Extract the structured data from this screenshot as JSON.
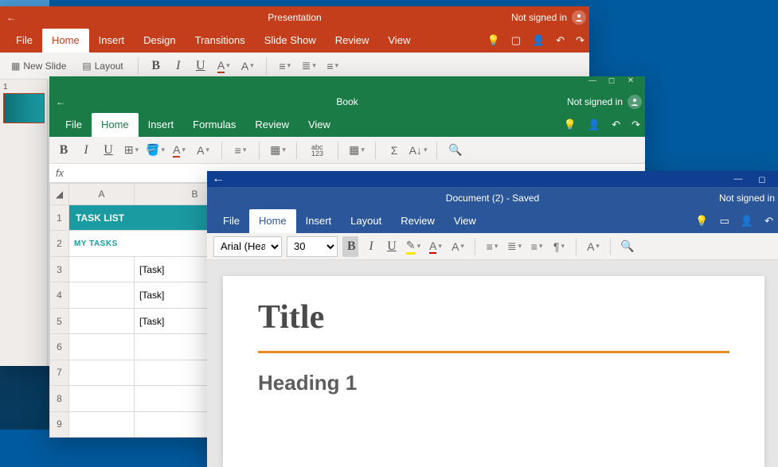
{
  "powerpoint": {
    "title": "Presentation",
    "signin": "Not signed in",
    "tabs": {
      "file": "File",
      "home": "Home",
      "insert": "Insert",
      "design": "Design",
      "transitions": "Transitions",
      "slideshow": "Slide Show",
      "review": "Review",
      "view": "View"
    },
    "ribbon": {
      "new_slide": "New Slide",
      "layout": "Layout",
      "bold": "B",
      "italic": "I",
      "underline": "U",
      "fontcolor": "A",
      "fontsize": "A"
    },
    "thumb_index": "1"
  },
  "excel": {
    "title": "Book",
    "signin": "Not signed in",
    "tabs": {
      "file": "File",
      "home": "Home",
      "insert": "Insert",
      "formulas": "Formulas",
      "review": "Review",
      "view": "View"
    },
    "ribbon": {
      "bold": "B",
      "italic": "I",
      "underline": "U",
      "abc": "abc",
      "num": "123"
    },
    "fx": "fx",
    "cols": {
      "a": "A",
      "b": "B"
    },
    "rows": [
      "1",
      "2",
      "3",
      "4",
      "5",
      "6",
      "7",
      "8",
      "9"
    ],
    "task_header": "TASK LIST",
    "task_sub": "MY TASKS",
    "tasks": [
      "[Task]",
      "[Task]",
      "[Task]"
    ]
  },
  "word": {
    "title": "Document (2) - Saved",
    "signin": "Not signed in",
    "tabs": {
      "file": "File",
      "home": "Home",
      "insert": "Insert",
      "layout": "Layout",
      "review": "Review",
      "view": "View"
    },
    "ribbon": {
      "font": "Arial (Head...",
      "size": "30",
      "bold": "B",
      "italic": "I",
      "underline": "U",
      "fontcolor": "A",
      "styleA": "A"
    },
    "doc": {
      "title": "Title",
      "h1": "Heading 1"
    }
  }
}
